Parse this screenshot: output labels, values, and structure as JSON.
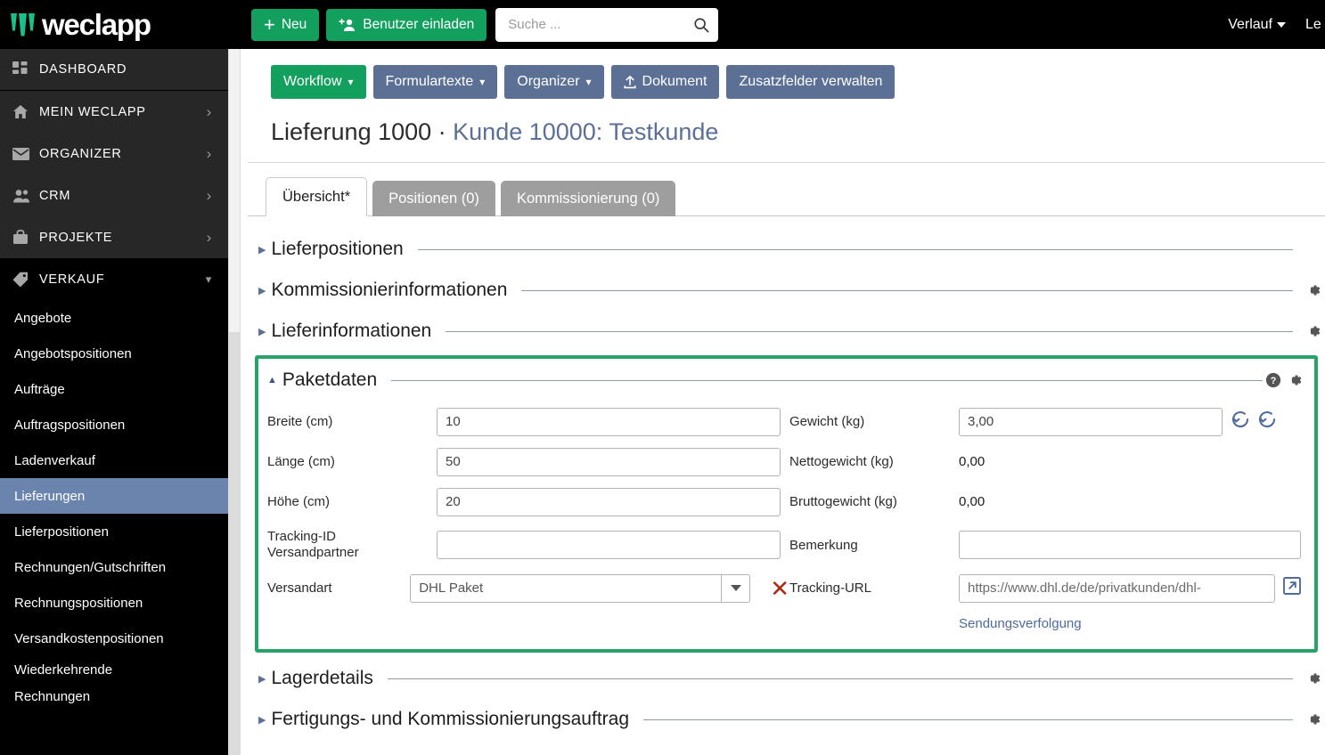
{
  "brand": {
    "name": "weclapp",
    "accent": "#13a05f",
    "highlight_border": "#27a269"
  },
  "topbar": {
    "new_label": "Neu",
    "invite_label": "Benutzer einladen",
    "search_placeholder": "Suche ...",
    "search_value": "",
    "history_label": "Verlauf",
    "logout_label": "Le"
  },
  "sidebar": {
    "dashboard": "DASHBOARD",
    "groups": [
      {
        "label": "MEIN WECLAPP",
        "icon": "home-icon",
        "expanded": false
      },
      {
        "label": "ORGANIZER",
        "icon": "envelope-icon",
        "expanded": false
      },
      {
        "label": "CRM",
        "icon": "users-icon",
        "expanded": false
      },
      {
        "label": "PROJEKTE",
        "icon": "briefcase-icon",
        "expanded": false
      },
      {
        "label": "VERKAUF",
        "icon": "tag-icon",
        "expanded": true
      }
    ],
    "verkauf_items": [
      {
        "label": "Angebote",
        "active": false
      },
      {
        "label": "Angebotspositionen",
        "active": false
      },
      {
        "label": "Aufträge",
        "active": false
      },
      {
        "label": "Auftragspositionen",
        "active": false
      },
      {
        "label": "Ladenverkauf",
        "active": false
      },
      {
        "label": "Lieferungen",
        "active": true
      },
      {
        "label": "Lieferpositionen",
        "active": false
      },
      {
        "label": "Rechnungen/Gutschriften",
        "active": false
      },
      {
        "label": "Rechnungspositionen",
        "active": false
      },
      {
        "label": "Versandkostenpositionen",
        "active": false
      },
      {
        "label": "Wiederkehrende",
        "active": false
      },
      {
        "label": "Rechnungen",
        "active": false
      }
    ]
  },
  "actions": [
    {
      "label": "Workflow",
      "style": "green",
      "caret": true,
      "icon": ""
    },
    {
      "label": "Formulartexte",
      "style": "blue",
      "caret": true,
      "icon": ""
    },
    {
      "label": "Organizer",
      "style": "blue",
      "caret": true,
      "icon": ""
    },
    {
      "label": "Dokument",
      "style": "blue",
      "caret": false,
      "icon": "upload-icon"
    },
    {
      "label": "Zusatzfelder verwalten",
      "style": "blue",
      "caret": false,
      "icon": ""
    }
  ],
  "page": {
    "title_main": "Lieferung 1000",
    "title_sep": " · ",
    "title_customer": "Kunde 10000: Testkunde"
  },
  "tabs": [
    {
      "label": "Übersicht*",
      "active": true
    },
    {
      "label": "Positionen (0)",
      "active": false
    },
    {
      "label": "Kommissionierung (0)",
      "active": false
    }
  ],
  "sections_before": [
    {
      "label": "Lieferpositionen",
      "gear": false,
      "expanded": false
    },
    {
      "label": "Kommissionierinformationen",
      "gear": true,
      "expanded": false
    },
    {
      "label": "Lieferinformationen",
      "gear": true,
      "expanded": false
    }
  ],
  "sections_after": [
    {
      "label": "Lagerdetails",
      "gear": true,
      "expanded": false
    },
    {
      "label": "Fertigungs- und Kommissionierungsauftrag",
      "gear": true,
      "expanded": false
    }
  ],
  "paketdaten": {
    "title": "Paketdaten",
    "help_icon": "help-circle-icon",
    "gear_icon": "gear-icon",
    "left": {
      "breite_label": "Breite (cm)",
      "breite_value": "10",
      "laenge_label": "Länge (cm)",
      "laenge_value": "50",
      "hoehe_label": "Höhe (cm)",
      "hoehe_value": "20",
      "tracking_id_label_l1": "Tracking-ID",
      "tracking_id_label_l2": "Versandpartner",
      "tracking_id_value": "",
      "versandart_label": "Versandart",
      "versandart_value": "DHL Paket",
      "clear_icon": "close-x-icon"
    },
    "right": {
      "gewicht_label": "Gewicht (kg)",
      "gewicht_value": "3,00",
      "refresh_icon_1": "refresh-icon",
      "refresh_icon_2": "refresh-icon",
      "netto_label": "Nettogewicht (kg)",
      "netto_value": "0,00",
      "brutto_label": "Bruttogewicht (kg)",
      "brutto_value": "0,00",
      "bemerkung_label": "Bemerkung",
      "bemerkung_value": "",
      "tracking_url_label": "Tracking-URL",
      "tracking_url_value": "https://www.dhl.de/de/privatkunden/dhl-",
      "open_icon": "external-link-icon",
      "tracking_link": "Sendungsverfolgung"
    }
  }
}
